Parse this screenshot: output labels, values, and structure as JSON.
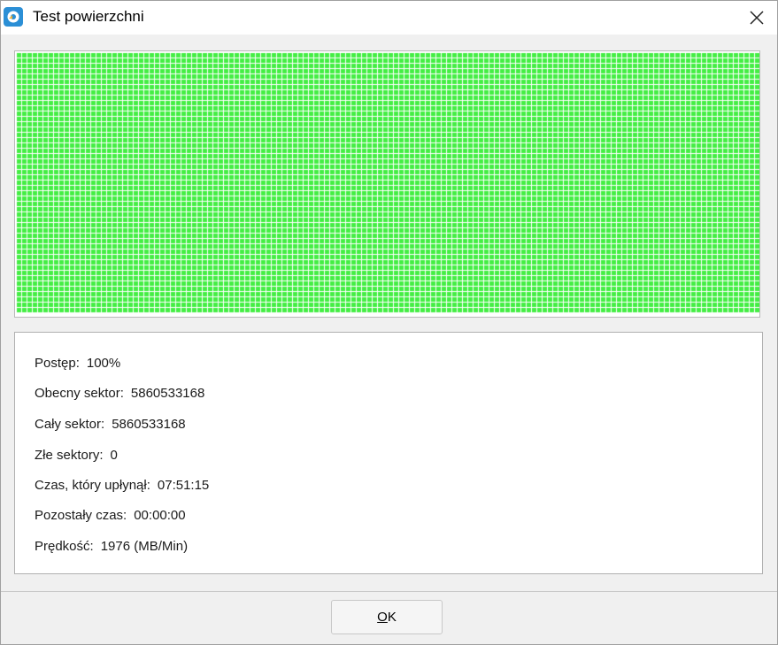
{
  "window": {
    "title": "Test powierzchni",
    "icon": "app-icon",
    "close_icon": "close-icon"
  },
  "surface_map": {
    "status": "all-sectors-good",
    "block_color": "#44ee44",
    "grid_color": "#ffffff"
  },
  "info": {
    "progress": {
      "label": "Postęp:",
      "value": "100%"
    },
    "current_sector": {
      "label": "Obecny sektor:",
      "value": "5860533168"
    },
    "total_sectors": {
      "label": "Cały sektor:",
      "value": "5860533168"
    },
    "bad_sectors": {
      "label": "Złe sektory:",
      "value": "0"
    },
    "elapsed": {
      "label": "Czas, który upłynął:",
      "value": "07:51:15"
    },
    "remaining": {
      "label": "Pozostały czas:",
      "value": "00:00:00"
    },
    "speed": {
      "label": "Prędkość:",
      "value": "1976 (MB/Min)"
    }
  },
  "ok_button": {
    "accel": "O",
    "rest": "K"
  }
}
